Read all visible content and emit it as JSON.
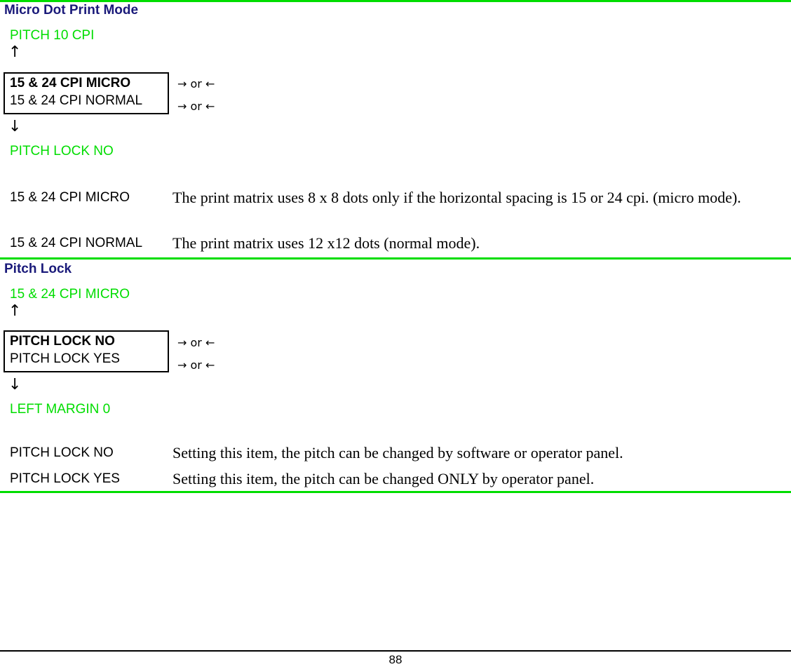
{
  "page": {
    "number": "88",
    "accent_green": "#00dd00",
    "heading_blue": "#1a1a7a"
  },
  "sections": [
    {
      "heading": "Micro Dot Print Mode",
      "menu_above": "PITCH 10 CPI",
      "arrow_up": "↑",
      "arrow_down": "↓",
      "options": [
        {
          "label": "15 & 24 CPI  MICRO",
          "selected": true,
          "hint": "→ or ←"
        },
        {
          "label": "15 & 24 CPI NORMAL",
          "selected": false,
          "hint": "→ or ←"
        }
      ],
      "menu_below": "PITCH LOCK NO",
      "descriptions": [
        {
          "term": "15 & 24 CPI MICRO",
          "text": "The print matrix uses 8 x 8 dots only if the horizontal spacing is 15 or 24 cpi. (micro mode)."
        },
        {
          "term": "15 & 24 CPI NORMAL",
          "text": "The print matrix uses 12 x12 dots (normal  mode)."
        }
      ]
    },
    {
      "heading": "Pitch Lock",
      "menu_above": "15 & 24 CPI  MICRO",
      "arrow_up": "↑",
      "arrow_down": "↓",
      "options": [
        {
          "label": "PITCH LOCK NO",
          "selected": true,
          "hint": "→ or ←"
        },
        {
          "label": "PITCH LOCK YES",
          "selected": false,
          "hint": "→ or ←"
        }
      ],
      "menu_below": "LEFT MARGIN  0",
      "descriptions": [
        {
          "term": "PITCH LOCK NO",
          "text": "Setting this item, the pitch can be changed by software or operator panel."
        },
        {
          "term": "PITCH LOCK YES",
          "text": "Setting this item, the pitch can be changed ONLY by operator panel."
        }
      ]
    }
  ]
}
